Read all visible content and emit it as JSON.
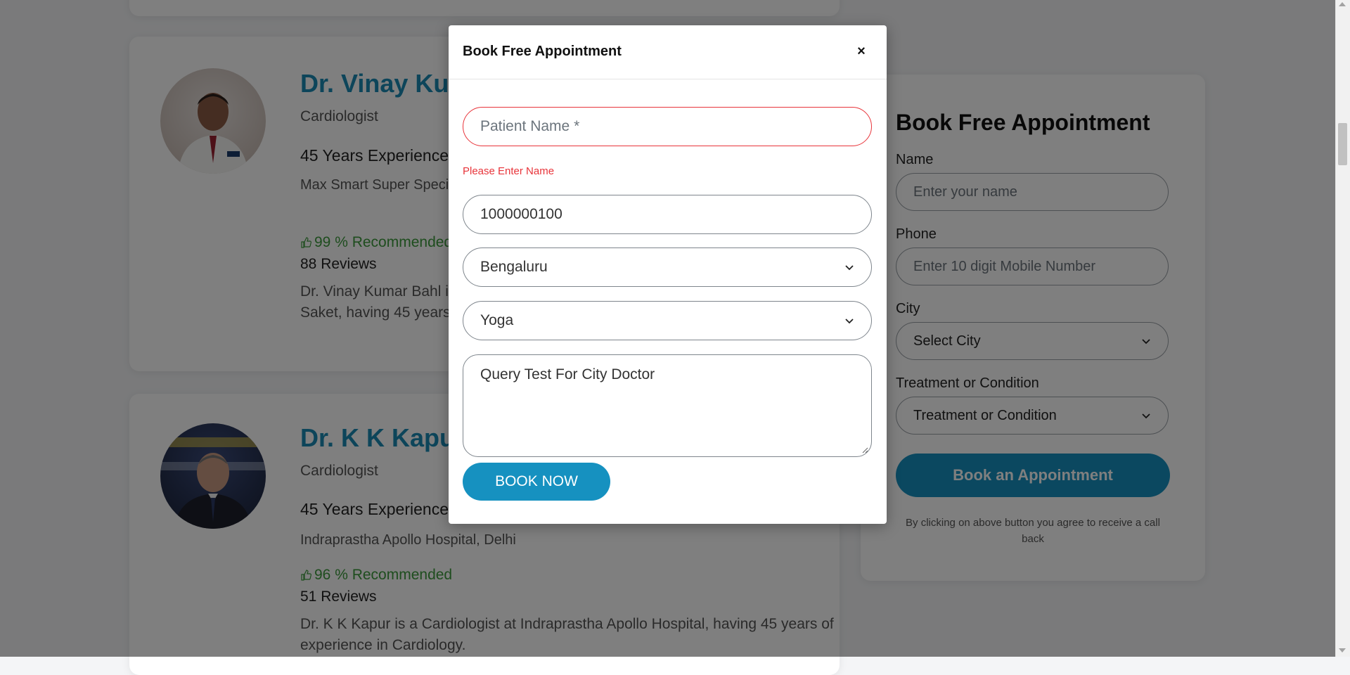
{
  "doctors": [
    {
      "name": "Dr. Vinay Kumar Bahl",
      "specialty": "Cardiologist",
      "experience": "45 Years Experience",
      "hospital": "Max Smart Super Speciality Hospital, Saket, Delhi",
      "recommended": "99 % Recommended",
      "reviews": "88 Reviews",
      "description": "Dr. Vinay Kumar Bahl is a Cardiologist at Max Smart Super Speciality Hospital, Saket, having 45 years of experience in Cardiology."
    },
    {
      "name": "Dr. K K Kapur",
      "specialty": "Cardiologist",
      "experience": "45 Years Experience",
      "hospital": "Indraprastha Apollo Hospital, Delhi",
      "recommended": "96 % Recommended",
      "reviews": "51 Reviews",
      "description": "Dr. K K Kapur is a Cardiologist at Indraprastha Apollo Hospital, having 45 years of experience in Cardiology."
    }
  ],
  "sidebar": {
    "title": "Book Free Appointment",
    "name_label": "Name",
    "name_placeholder": "Enter your name",
    "phone_label": "Phone",
    "phone_placeholder": "Enter 10 digit Mobile Number",
    "city_label": "City",
    "city_value": "Select City",
    "treatment_label": "Treatment or Condition",
    "treatment_value": "Treatment or Condition",
    "button": "Book an Appointment",
    "note": "By clicking on above button you agree to receive a call back"
  },
  "modal": {
    "title": "Book Free Appointment",
    "close": "×",
    "name_placeholder": "Patient Name *",
    "name_error": "Please Enter Name",
    "phone_value": "1000000100",
    "city_value": "Bengaluru",
    "treatment_value": "Yoga",
    "query_value": "Query Test For City Doctor",
    "button": "BOOK NOW"
  },
  "colors": {
    "accent": "#1691c0",
    "doctor_name": "#1a8ab5",
    "recommend": "#3c9a3c",
    "error": "#e8343a"
  }
}
